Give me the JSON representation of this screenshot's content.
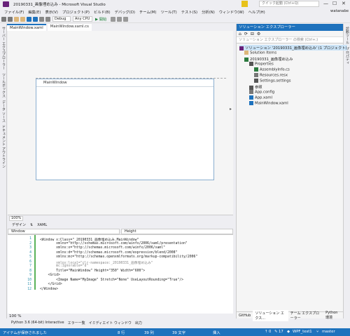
{
  "title_bar": {
    "title": "20190331_画像埋め込み - Microsoft Visual Studio",
    "quick_launch_placeholder": "クイック起動 (Ctrl+Q)",
    "minimize": "—",
    "maximize": "☐",
    "close": "✕"
  },
  "menu": {
    "items": [
      "ファイル(F)",
      "編集(E)",
      "表示(V)",
      "プロジェクト(P)",
      "ビルド(B)",
      "デバッグ(D)",
      "チーム(M)",
      "ツール(T)",
      "テスト(S)",
      "分析(N)",
      "ウィンドウ(W)",
      "ヘルプ(H)"
    ],
    "user": "watanabe"
  },
  "toolbar": {
    "config": "Debug",
    "platform": "Any CPU",
    "start_label": "▶ 開始"
  },
  "left_strip": {
    "labels": [
      "サーバー エクスプローラー",
      "ツールボックス",
      "データ ソース",
      "ドキュメント アウトライン"
    ]
  },
  "right_strip": {
    "labels": [
      "診断ツール",
      "プロパティ"
    ]
  },
  "doc_tabs": {
    "tab1": "MainWindow.xaml",
    "tab2": "MainWindow.xaml.cs"
  },
  "designer": {
    "window_title": "MainWindow"
  },
  "split": {
    "zoom": "100%"
  },
  "view_tabs": {
    "design": "デザイン",
    "swap": "⇅",
    "xaml": "XAML"
  },
  "nav": {
    "left": "Window",
    "right": "Height"
  },
  "code_lines": [
    {
      "n": "1",
      "t": "<Window x:Class=\"_20190331_画像埋め込み.MainWindow\""
    },
    {
      "n": "2",
      "t": "        xmlns=\"http://schemas.microsoft.com/winfx/2006/xaml/presentation\""
    },
    {
      "n": "3",
      "t": "        xmlns:x=\"http://schemas.microsoft.com/winfx/2006/xaml\""
    },
    {
      "n": "4",
      "t": "        xmlns:d=\"http://schemas.microsoft.com/expression/blend/2008\""
    },
    {
      "n": "5",
      "t": "        xmlns:mc=\"http://schemas.openxmlformats.org/markup-compatibility/2006\""
    },
    {
      "n": "6",
      "t": "        xmlns:local=\"clr-namespace:_20190331_画像埋め込み\""
    },
    {
      "n": "7",
      "t": "        mc:Ignorable=\"d\""
    },
    {
      "n": "8",
      "t": "        Title=\"MainWindow\" Height=\"350\" Width=\"600\">"
    },
    {
      "n": "9",
      "t": "    <Grid>"
    },
    {
      "n": "10",
      "t": "        <Image Name=\"MyImage\" Stretch=\"None\" UseLayoutRounding=\"True\"/>"
    },
    {
      "n": "11",
      "t": "    </Grid>"
    },
    {
      "n": "12",
      "t": "</Window>"
    }
  ],
  "editor_zoom": "100 %",
  "bottom_tabs": [
    "Python 3.6 (64-bit) Interactive",
    "エラー一覧",
    "イミディエイト ウィンドウ",
    "出力"
  ],
  "solution_explorer": {
    "header": "ソリューション エクスプローラー",
    "search_placeholder": "ソリューション エクスプローラー の検索 (Ctrl+;)",
    "tree": [
      {
        "label": "ソリューション '20190331_画像埋め込み' (1 プロジェクト)",
        "indent": 0,
        "icon": "solution-icon",
        "color": "#68217a"
      },
      {
        "label": "Solution Items",
        "indent": 1,
        "icon": "folder-icon",
        "color": "#dcb67a"
      },
      {
        "label": "20190331_画像埋め込み",
        "indent": 1,
        "icon": "csharp-project-icon",
        "color": "#2b7a3e"
      },
      {
        "label": "Properties",
        "indent": 2,
        "icon": "wrench-icon",
        "color": "#555555"
      },
      {
        "label": "AssemblyInfo.cs",
        "indent": 3,
        "icon": "csharp-file-icon",
        "color": "#2b7a3e"
      },
      {
        "label": "Resources.resx",
        "indent": 3,
        "icon": "resource-icon",
        "color": "#777777"
      },
      {
        "label": "Settings.settings",
        "indent": 3,
        "icon": "gear-icon",
        "color": "#555555"
      },
      {
        "label": "参照",
        "indent": 2,
        "icon": "reference-icon",
        "color": "#555555"
      },
      {
        "label": "App.config",
        "indent": 2,
        "icon": "config-icon",
        "color": "#777777"
      },
      {
        "label": "App.xaml",
        "indent": 2,
        "icon": "xaml-file-icon",
        "color": "#1e72bd"
      },
      {
        "label": "MainWindow.xaml",
        "indent": 2,
        "icon": "xaml-file-icon",
        "color": "#1e72bd"
      }
    ],
    "tabs": [
      "GitHub",
      "ソリューション エクス...",
      "チーム エクスプローラー",
      "Python 環境"
    ]
  },
  "status": {
    "message": "アイテムが保存されました",
    "line": "8 行",
    "col": "39 列",
    "char": "39 文字",
    "mode": "挿入",
    "up": "0",
    "pencil": "17",
    "repo": "WPF_test1",
    "branch": "master"
  },
  "colors": {
    "accent": "#1e72bd",
    "status_bar": "#1e72bd",
    "filter": "#e8c21a"
  }
}
